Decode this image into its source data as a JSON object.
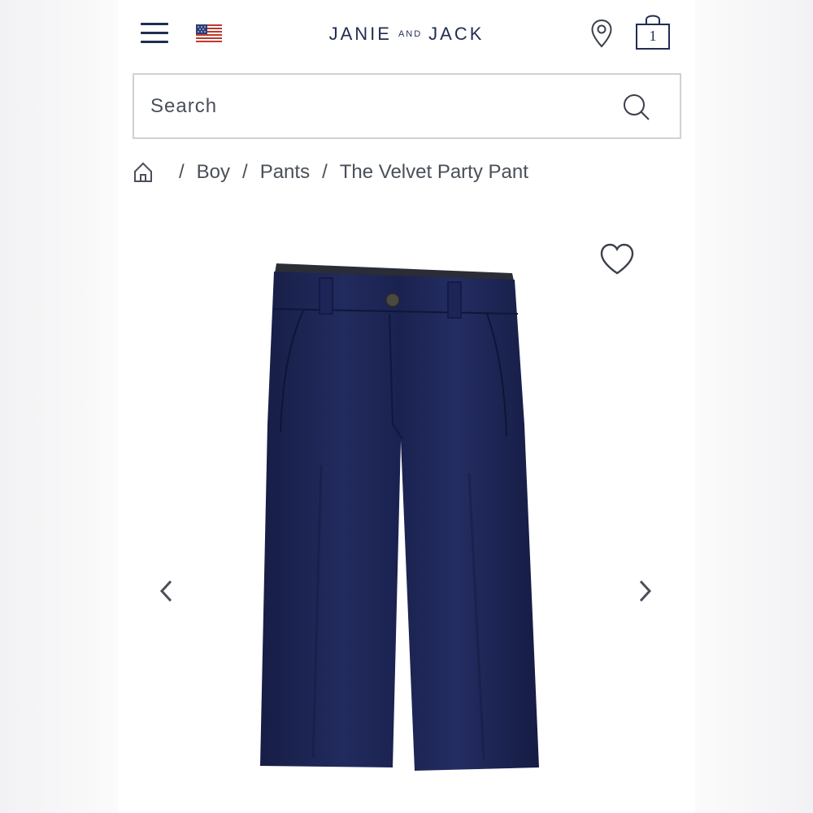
{
  "header": {
    "brand_left": "JANIE",
    "brand_mid": "AND",
    "brand_right": "JACK",
    "cart_count": "1",
    "icons": [
      "menu-icon",
      "us-flag-icon",
      "location-pin-icon",
      "shopping-bag-icon"
    ]
  },
  "search": {
    "placeholder": "Search",
    "icon": "search-icon"
  },
  "breadcrumb": {
    "home_icon": "home-icon",
    "separator": "/",
    "items": [
      "Boy",
      "Pants",
      "The Velvet Party Pant"
    ]
  },
  "product": {
    "image_alt": "Navy velvet pants",
    "wishlist_icon": "heart-icon",
    "prev_icon": "chevron-left-icon",
    "next_icon": "chevron-right-icon",
    "fabric_color": "#1c2453"
  },
  "colors": {
    "brand": "#1f2d52",
    "text": "#4a4f5a",
    "border": "#cfd1d6"
  }
}
